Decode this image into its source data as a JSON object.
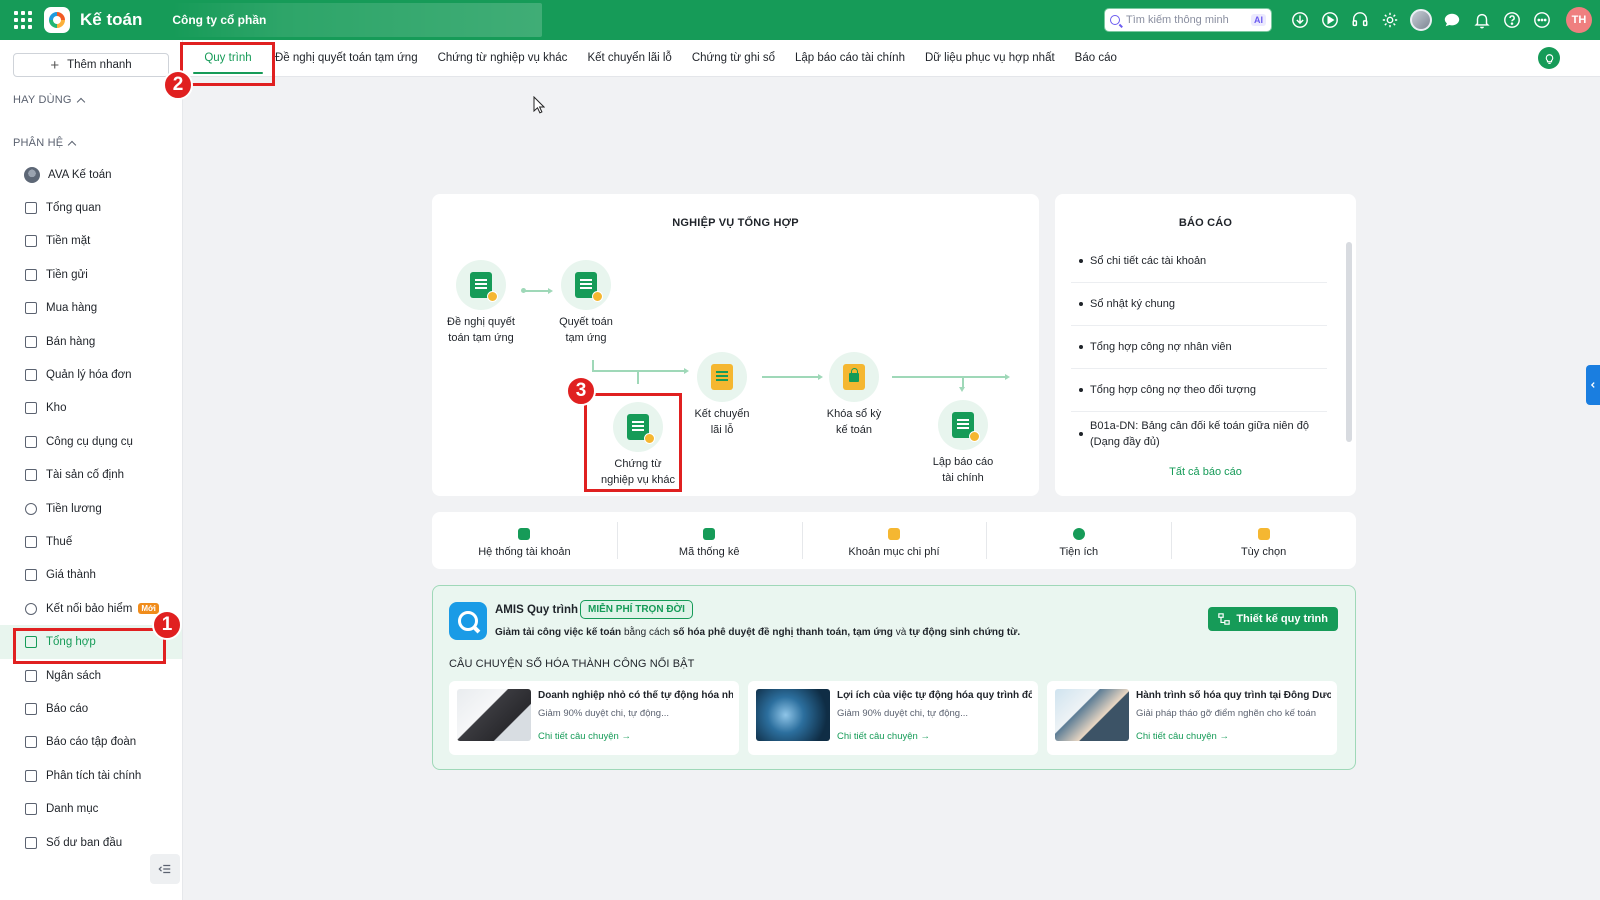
{
  "header": {
    "app_title": "Kế toán",
    "company": "Công ty cổ phần",
    "search_placeholder": "Tìm kiếm thông minh",
    "ai_label": "AI",
    "user_initials": "TH"
  },
  "tabs": [
    {
      "label": "Quy trình",
      "active": true
    },
    {
      "label": "Đề nghị quyết toán tạm ứng"
    },
    {
      "label": "Chứng từ nghiệp vụ khác"
    },
    {
      "label": "Kết chuyển lãi lỗ"
    },
    {
      "label": "Chứng từ ghi sổ"
    },
    {
      "label": "Lập báo cáo tài chính"
    },
    {
      "label": "Dữ liệu phục vụ hợp nhất"
    },
    {
      "label": "Báo cáo"
    }
  ],
  "sidebar": {
    "add_branch": "Thêm nhanh",
    "section_recent": "HAY DÙNG",
    "section_modules": "PHÂN HỆ",
    "new_badge": "Mới",
    "items": [
      {
        "label": "AVA Kế toán"
      },
      {
        "label": "Tổng quan"
      },
      {
        "label": "Tiền mặt"
      },
      {
        "label": "Tiền gửi"
      },
      {
        "label": "Mua hàng"
      },
      {
        "label": "Bán hàng"
      },
      {
        "label": "Quản lý hóa đơn"
      },
      {
        "label": "Kho"
      },
      {
        "label": "Công cụ dụng cụ"
      },
      {
        "label": "Tài sản cố định"
      },
      {
        "label": "Tiền lương"
      },
      {
        "label": "Thuế"
      },
      {
        "label": "Giá thành"
      },
      {
        "label": "Kết nối bảo hiểm"
      },
      {
        "label": "Tổng hợp",
        "active": true
      },
      {
        "label": "Ngân sách"
      },
      {
        "label": "Báo cáo"
      },
      {
        "label": "Báo cáo tập đoàn"
      },
      {
        "label": "Phân tích tài chính"
      },
      {
        "label": "Danh mục"
      },
      {
        "label": "Số dư ban đầu"
      }
    ]
  },
  "callouts": {
    "one": "1",
    "two": "2",
    "three": "3"
  },
  "process": {
    "title": "NGHIỆP VỤ TỔNG HỢP",
    "nodes": {
      "de_nghi_l1": "Đề nghị quyết",
      "de_nghi_l2": "toán tạm ứng",
      "quyet_toan_l1": "Quyết toán",
      "quyet_toan_l2": "tạm ứng",
      "chung_tu_l1": "Chứng từ",
      "chung_tu_l2": "nghiệp vụ khác",
      "ket_chuyen_l1": "Kết chuyển",
      "ket_chuyen_l2": "lãi lỗ",
      "khoa_so_l1": "Khóa sổ kỳ",
      "khoa_so_l2": "kế toán",
      "lap_bc_l1": "Lập báo cáo",
      "lap_bc_l2": "tài chính"
    }
  },
  "reports": {
    "title": "BÁO CÁO",
    "items": [
      "Sổ chi tiết các tài khoản",
      "Sổ nhật ký chung",
      "Tổng hợp công nợ nhân viên",
      "Tổng hợp công nợ theo đối tượng",
      "B01a-DN: Bảng cân đối kế toán giữa niên độ (Dạng đầy đủ)"
    ],
    "all_link": "Tất cả báo cáo"
  },
  "tools": [
    {
      "label": "Hệ thống tài khoản"
    },
    {
      "label": "Mã thống kê"
    },
    {
      "label": "Khoản mục chi phí"
    },
    {
      "label": "Tiện ích"
    },
    {
      "label": "Tùy chọn"
    }
  ],
  "promo": {
    "name": "AMIS Quy trình",
    "badge": "MIỄN PHÍ TRỌN ĐỜI",
    "desc_a": "Giảm tải công việc kế toán",
    "desc_b": "bằng cách",
    "desc_c": "số hóa phê duyệt đề nghị thanh toán, tạm ứng",
    "desc_d": "và",
    "desc_e": "tự động sinh chứng từ.",
    "design_button": "Thiết kế quy trình",
    "stories_title": "CÂU CHUYỆN SỐ HÓA THÀNH CÔNG NỔI BẬT",
    "stories": [
      {
        "title": "Doanh nghiệp nhỏ có thể tự động hóa nhữ...",
        "sub": "Giảm 90% duyệt chi, tự động...",
        "link": "Chi tiết câu chuyện"
      },
      {
        "title": "Lợi ích của việc tự động hóa quy trình đối v...",
        "sub": "Giảm 90% duyệt chi, tự động...",
        "link": "Chi tiết câu chuyện"
      },
      {
        "title": "Hành trình số hóa quy trình tại Đông Dươn...",
        "sub": "Giải pháp tháo gỡ điểm nghẽn cho kế toán",
        "link": "Chi tiết câu chuyện"
      }
    ]
  },
  "colors": {
    "brand": "#169b58",
    "callout": "#e02020",
    "accent_blue": "#1a7ee0"
  }
}
